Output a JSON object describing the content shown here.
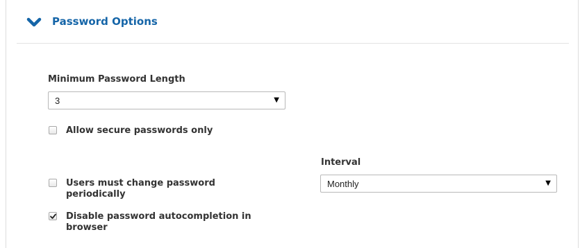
{
  "section": {
    "title": "Password Options",
    "icon": "chevron-down-icon",
    "accent_color": "#1565a8"
  },
  "min_length": {
    "label": "Minimum Password Length",
    "value": "3"
  },
  "checkboxes": {
    "secure_only": {
      "label": "Allow secure passwords only",
      "checked": false
    },
    "change_periodically": {
      "label": "Users must change password periodically",
      "checked": false
    },
    "disable_autocomplete": {
      "label": "Disable password autocompletion in browser",
      "checked": true
    }
  },
  "interval": {
    "label": "Interval",
    "value": "Monthly"
  }
}
